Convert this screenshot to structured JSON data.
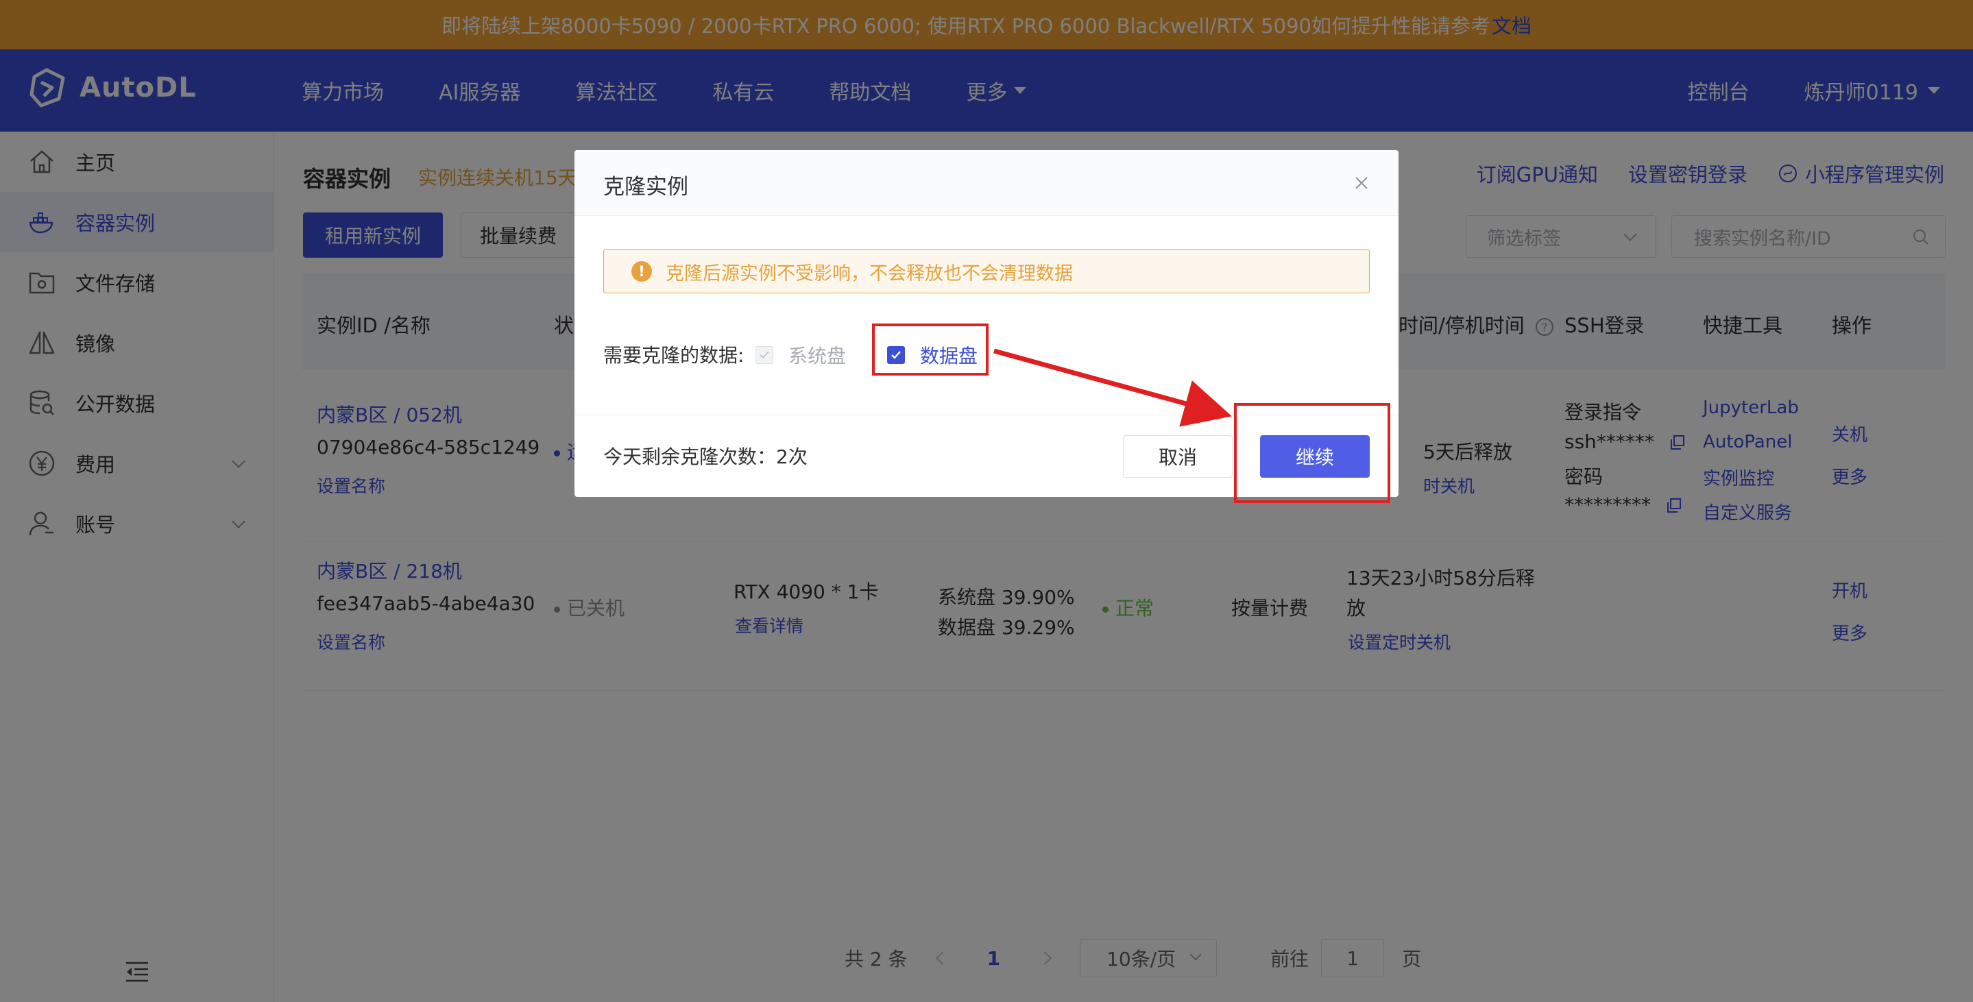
{
  "banner": {
    "text": "即将陆续上架8000卡5090 / 2000卡RTX PRO 6000; 使用RTX PRO 6000 Blackwell/RTX 5090如何提升性能请参考",
    "link": "文档"
  },
  "navbar": {
    "logo": "AutoDL",
    "items": [
      "算力市场",
      "AI服务器",
      "算法社区",
      "私有云",
      "帮助文档",
      "更多"
    ],
    "console": "控制台",
    "user": "炼丹师0119"
  },
  "sidebar": {
    "items": [
      {
        "label": "主页"
      },
      {
        "label": "容器实例"
      },
      {
        "label": "文件存储"
      },
      {
        "label": "镜像"
      },
      {
        "label": "公开数据"
      },
      {
        "label": "费用"
      },
      {
        "label": "账号"
      }
    ]
  },
  "main": {
    "title": "容器实例",
    "title_note": "实例连续关机15天",
    "top_links": [
      "订阅GPU通知",
      "设置密钥登录",
      "小程序管理实例"
    ],
    "btn_new": "租用新实例",
    "btn_renew": "批量续费",
    "filter_placeholder": "筛选标签",
    "search_placeholder": "搜索实例名称/ID"
  },
  "table": {
    "headers": {
      "id": "实例ID /名称",
      "status": "状",
      "time": "时间/停机时间",
      "ssh": "SSH登录",
      "tools": "快捷工具",
      "ops": "操作"
    },
    "rows": [
      {
        "name": "内蒙B区 / 052机",
        "id": "07904e86c4-585c1249",
        "set_name": "设置名称",
        "status": "运",
        "release": "5天后释放",
        "timer": "时关机",
        "ssh_cmd_label": "登录指令",
        "ssh_cmd": "ssh******",
        "ssh_pwd_label": "密码",
        "ssh_pwd": "*********",
        "tools": [
          "JupyterLab",
          "AutoPanel",
          "实例监控",
          "自定义服务"
        ],
        "ops": [
          "关机",
          "更多"
        ]
      },
      {
        "name": "内蒙B区 / 218机",
        "id": "fee347aab5-4abe4a30",
        "set_name": "设置名称",
        "status": "已关机",
        "gpu": "RTX 4090 * 1卡",
        "gpu_detail": "查看详情",
        "disk_sys": "系统盘 39.90%",
        "disk_data": "数据盘 39.29%",
        "health": "正常",
        "billing": "按量计费",
        "release_line1": "13天23小时58分后释",
        "release_line2": "放",
        "timer": "设置定时关机",
        "ops": [
          "开机",
          "更多"
        ]
      }
    ]
  },
  "pagination": {
    "total": "共 2 条",
    "current": "1",
    "page_size": "10条/页",
    "goto": "前往",
    "goto_value": "1",
    "page_suffix": "页"
  },
  "dialog": {
    "title": "克隆实例",
    "alert": "克隆后源实例不受影响，不会释放也不会清理数据",
    "clone_label": "需要克隆的数据:",
    "option_system": "系统盘",
    "option_data": "数据盘",
    "remaining": "今天剩余克隆次数：2次",
    "cancel": "取消",
    "continue": "继续"
  },
  "colors": {
    "primary": "#3c4fd6",
    "banner": "#f1a035",
    "warning": "#e6a23c",
    "success": "#67c23a",
    "annotation": "#e02020"
  }
}
